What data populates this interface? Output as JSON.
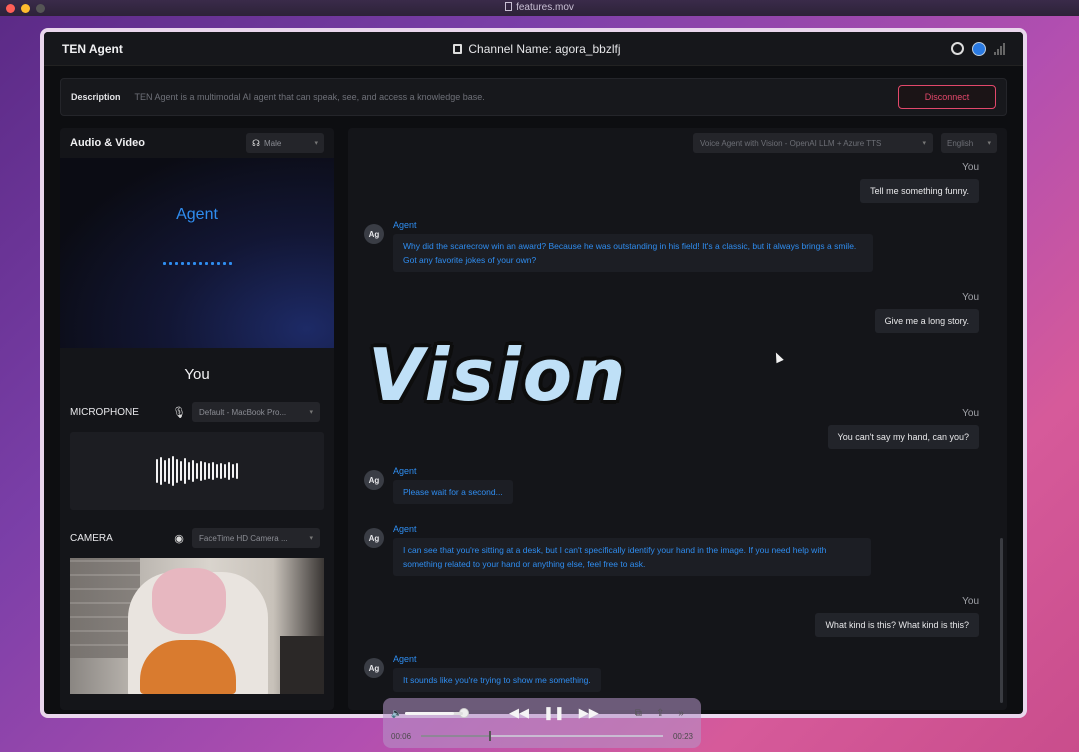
{
  "mac": {
    "file_title": "features.mov"
  },
  "header": {
    "brand": "TEN Agent",
    "channel_label": "Channel Name: agora_bbzlfj"
  },
  "description": {
    "label": "Description",
    "text": "TEN Agent is a multimodal AI agent that can speak, see, and access a knowledge base.",
    "disconnect_label": "Disconnect"
  },
  "left": {
    "title": "Audio & Video",
    "voice_select": "Male",
    "agent_label": "Agent",
    "you_label": "You",
    "microphone_label": "MICROPHONE",
    "microphone_select": "Default - MacBook Pro...",
    "camera_label": "CAMERA",
    "camera_select": "FaceTime HD Camera ..."
  },
  "right": {
    "pipeline_select": "Voice Agent with Vision - OpenAI LLM + Azure TTS",
    "language_select": "English",
    "user_name": "You",
    "agent_name": "Agent",
    "avatar_text": "Ag",
    "messages": [
      {
        "role": "user",
        "text": "Tell me something funny."
      },
      {
        "role": "agent",
        "text": "Why did the scarecrow win an award? Because he was outstanding in his field! It's a classic, but it always brings a smile. Got any favorite jokes of your own?"
      },
      {
        "role": "user",
        "text": "Give me a long story."
      },
      {
        "role": "user",
        "text": "You can't say my hand, can you?"
      },
      {
        "role": "agent",
        "text": "Please wait for a second..."
      },
      {
        "role": "agent",
        "text": "I can see that you're sitting at a desk, but I can't specifically identify your hand in the image. If you need help with something related to your hand or anything else, feel free to ask."
      },
      {
        "role": "user",
        "text": "What kind is this? What kind is this?"
      },
      {
        "role": "agent",
        "text": "It sounds like you're trying to show me something."
      }
    ]
  },
  "overlay": {
    "text": "Vision"
  },
  "player": {
    "elapsed": "00:06",
    "remaining": "00:23",
    "volume_level": 0.85,
    "progress": 0.28
  },
  "icons": {
    "github": "github-icon",
    "network": "network-icon",
    "signal": "signal-icon",
    "voice": "voice-icon",
    "mic": "microphone-icon",
    "camera": "camera-icon"
  },
  "colors": {
    "accent": "#2f8df0",
    "danger": "#e2486b",
    "panel": "#141519"
  }
}
